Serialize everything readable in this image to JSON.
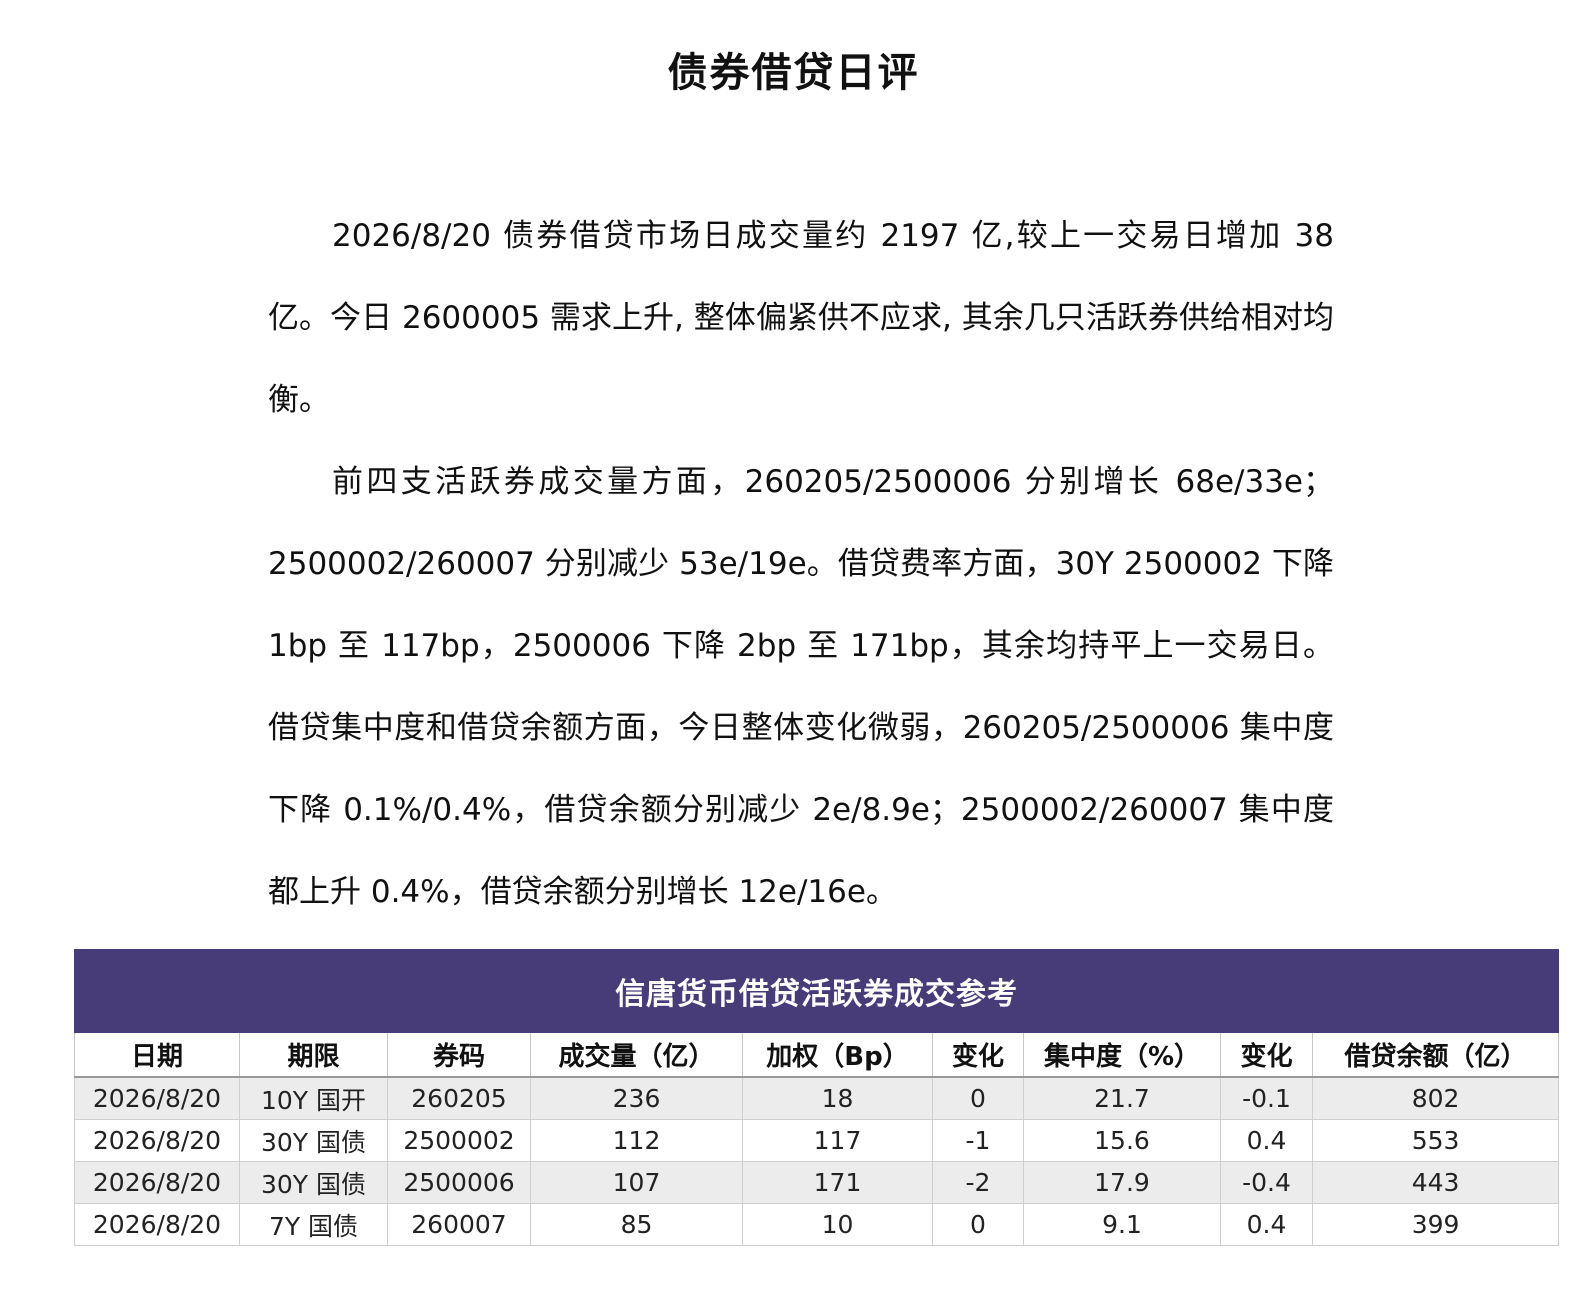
{
  "document": {
    "title": "债券借贷日评",
    "paragraphs": [
      "2026/8/20 债券借贷市场日成交量约 2197 亿,较上一交易日增加 38 亿。今日 2600005 需求上升, 整体偏紧供不应求, 其余几只活跃券供给相对均衡。",
      "前四支活跃券成交量方面，260205/2500006 分别增长 68e/33e；2500002/260007 分别减少 53e/19e。借贷费率方面，30Y 2500002 下降 1bp 至 117bp，2500006 下降 2bp 至 171bp，其余均持平上一交易日。借贷集中度和借贷余额方面，今日整体变化微弱，260205/2500006 集中度下降 0.1%/0.4%，借贷余额分别减少 2e/8.9e；2500002/260007 集中度都上升 0.4%，借贷余额分别增长 12e/16e。"
    ]
  },
  "table": {
    "title": "信唐货币借贷活跃券成交参考",
    "header_color": "#483c78",
    "columns": [
      "日期",
      "期限",
      "券码",
      "成交量（亿）",
      "加权（Bp）",
      "变化",
      "集中度（%）",
      "变化",
      "借贷余额（亿）"
    ],
    "rows": [
      [
        "2026/8/20",
        "10Y 国开",
        "260205",
        "236",
        "18",
        "0",
        "21.7",
        "-0.1",
        "802"
      ],
      [
        "2026/8/20",
        "30Y 国债",
        "2500002",
        "112",
        "117",
        "-1",
        "15.6",
        "0.4",
        "553"
      ],
      [
        "2026/8/20",
        "30Y 国债",
        "2500006",
        "107",
        "171",
        "-2",
        "17.9",
        "-0.4",
        "443"
      ],
      [
        "2026/8/20",
        "7Y 国债",
        "260007",
        "85",
        "10",
        "0",
        "9.1",
        "0.4",
        "399"
      ]
    ]
  }
}
